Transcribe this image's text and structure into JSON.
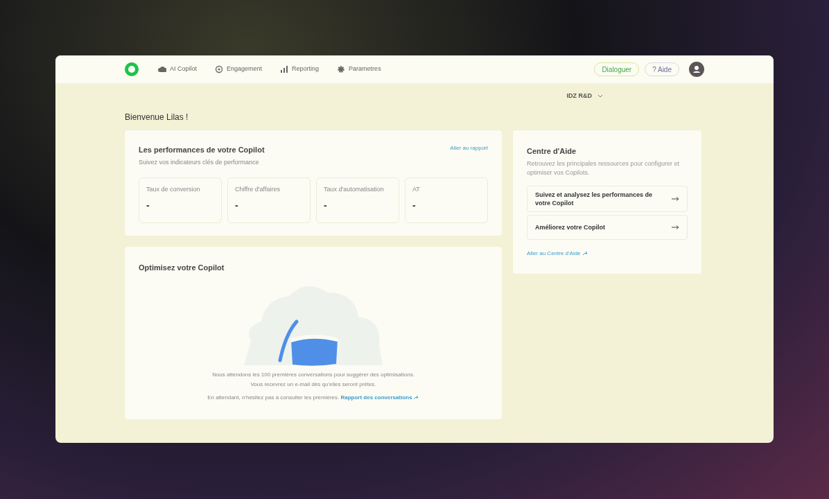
{
  "nav": [
    {
      "kind": "cloud",
      "label": "AI Copilot"
    },
    {
      "kind": "target",
      "label": "Engagement"
    },
    {
      "kind": "bars",
      "label": "Reporting"
    },
    {
      "kind": "gear",
      "label": "Parametres"
    }
  ],
  "header_buttons": {
    "primary": "Dialoguer",
    "help": "? Aide"
  },
  "workspace": "IDZ R&D",
  "greeting": "Bienvenue Lilas !",
  "performance": {
    "title": "Les performances de votre Copilot",
    "subtitle": "Suivez vos indicateurs clés de performance",
    "link": "Aller au rapport",
    "kpis": [
      {
        "label": "Taux de conversion",
        "value": "-"
      },
      {
        "label": "Chiffre d'affaires",
        "value": "-"
      },
      {
        "label": "Taux d'automatisation",
        "value": "-"
      },
      {
        "label": "AT",
        "value": "-"
      }
    ]
  },
  "optimize": {
    "title": "Optimisez votre Copilot",
    "message": [
      "Nous attendons les 100 premières conversations pour suggérer des optimisations.",
      "Vous recevrez un e-mail dès qu'elles seront prêtes."
    ],
    "hint": "En attendant, n'hésitez pas à consulter les premières.",
    "link": "Rapport des conversations"
  },
  "help_center": {
    "title": "Centre d'Aide",
    "subtitle": "Retrouvez les principales ressources pour configurer et optimiser vos Copilots.",
    "items": [
      "Suivez et analysez les performances de votre Copilot",
      "Améliorez votre Copilot"
    ],
    "link": "Aller au Centre d'Aide"
  }
}
